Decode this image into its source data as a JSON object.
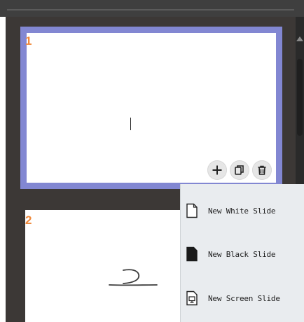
{
  "slides": [
    {
      "number": "1",
      "selected": true
    },
    {
      "number": "2",
      "selected": false
    }
  ],
  "slide_actions": {
    "add_icon": "plus-icon",
    "duplicate_icon": "copy-icon",
    "delete_icon": "trash-icon"
  },
  "new_slide_menu": {
    "items": [
      {
        "label": "New White Slide",
        "icon": "white-page-icon"
      },
      {
        "label": "New Black Slide",
        "icon": "black-page-icon"
      },
      {
        "label": "New Screen Slide",
        "icon": "screen-page-icon"
      }
    ]
  },
  "colors": {
    "selection_border": "#8287d2",
    "slide_number": "#f08a3c",
    "panel_background": "#3c3836",
    "menu_background": "#e9ecef"
  }
}
